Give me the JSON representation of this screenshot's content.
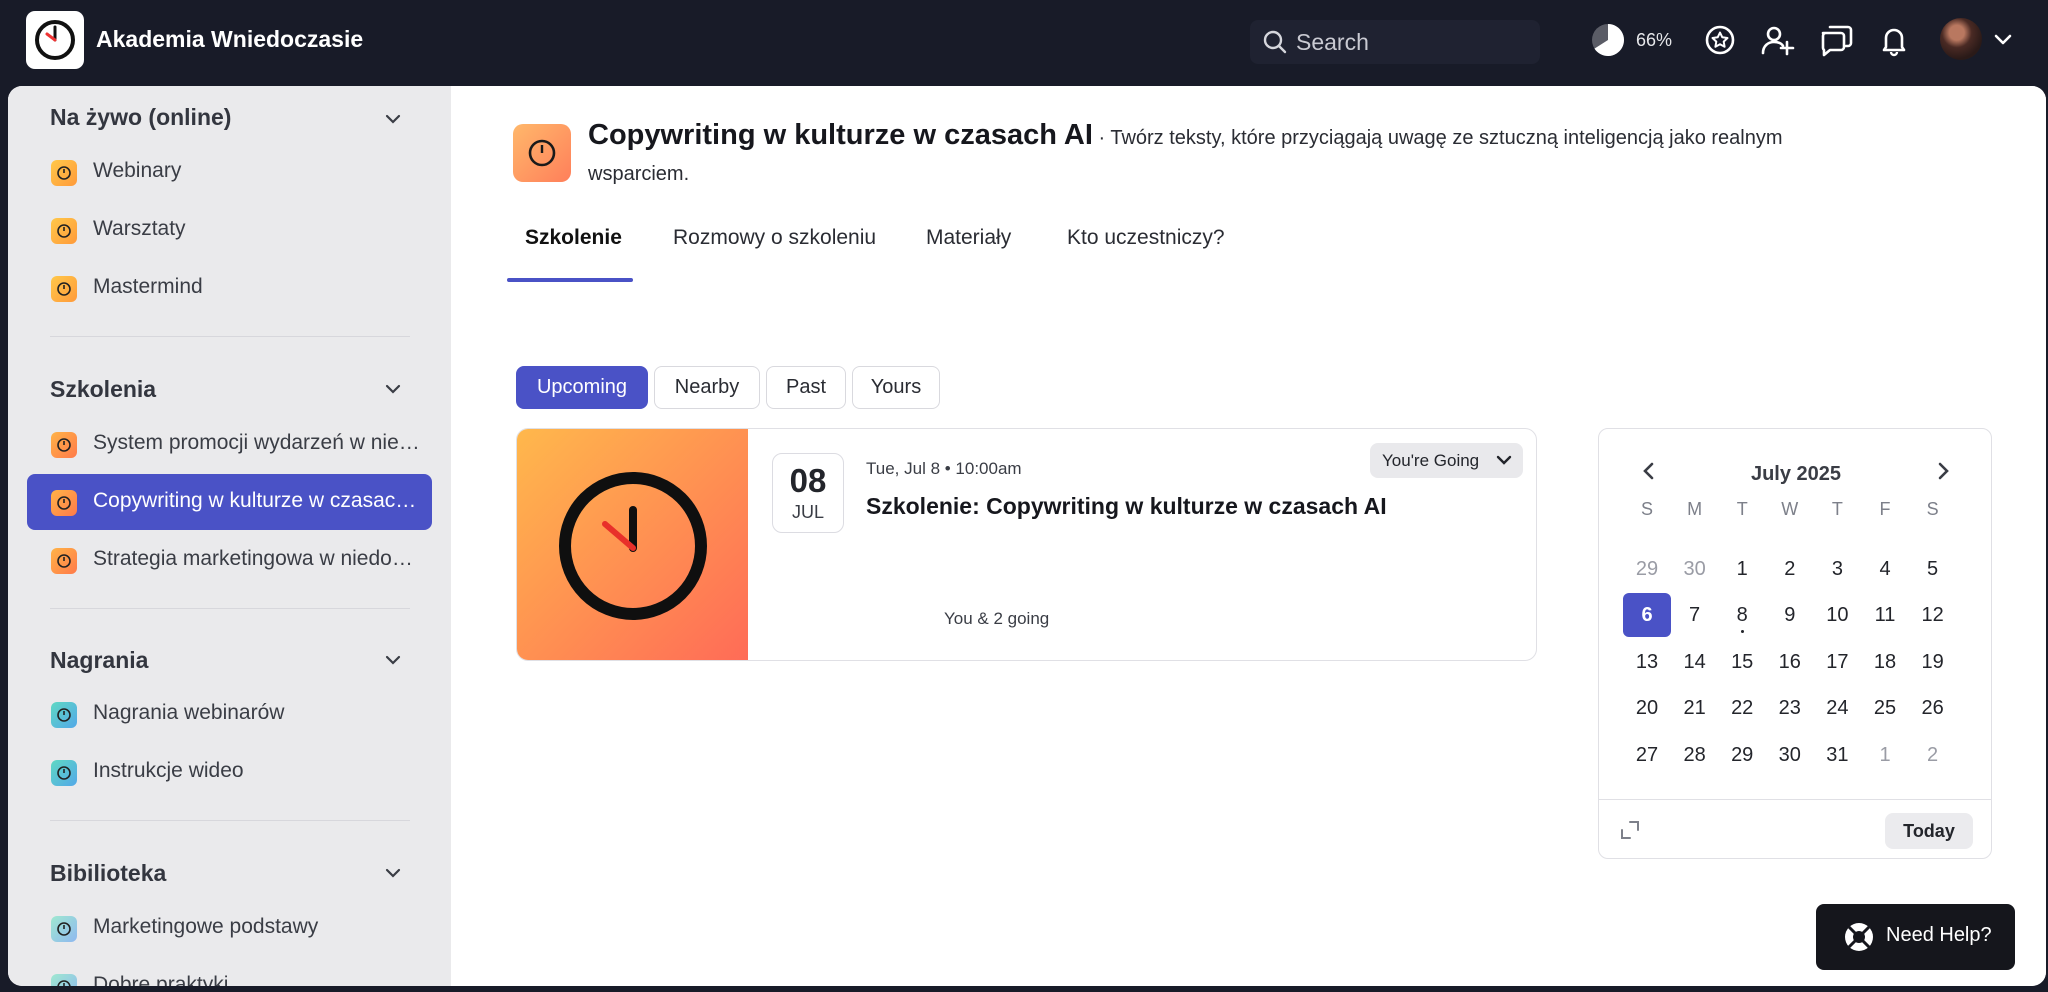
{
  "app": {
    "name": "Akademia Wniedoczasie"
  },
  "topbar": {
    "search_placeholder": "Search",
    "progress_label": "66%",
    "progress_value": 0.66
  },
  "sidebar": {
    "sections": [
      {
        "title": "Na żywo (online)",
        "items": [
          {
            "label": "Webinary",
            "icon": "clock-icon"
          },
          {
            "label": "Warsztaty",
            "icon": "clock-icon"
          },
          {
            "label": "Mastermind",
            "icon": "clock-icon"
          }
        ]
      },
      {
        "title": "Szkolenia",
        "items": [
          {
            "label": "System promocji wydarzeń w niedoczasie",
            "icon": "clock-icon"
          },
          {
            "label": "Copywriting w kulturze w czasach AI",
            "icon": "clock-icon",
            "active": true
          },
          {
            "label": "Strategia marketingowa w niedoczasie",
            "icon": "clock-icon"
          }
        ]
      },
      {
        "title": "Nagrania",
        "items": [
          {
            "label": "Nagrania webinarów",
            "icon": "clock-icon"
          },
          {
            "label": "Instrukcje wideo",
            "icon": "clock-icon"
          }
        ]
      },
      {
        "title": "Bibilioteka",
        "items": [
          {
            "label": "Marketingowe podstawy",
            "icon": "clock-icon"
          },
          {
            "label": "Dobre praktyki",
            "icon": "clock-icon"
          }
        ]
      }
    ]
  },
  "space": {
    "title": "Copywriting w kulturze w czasach AI",
    "separator": " · ",
    "description": "Twórz teksty, które przyciągają uwagę ze sztuczną inteligencją jako realnym wsparciem."
  },
  "tabs": [
    "Szkolenie",
    "Rozmowy o szkoleniu",
    "Materiały",
    "Kto uczestniczy?"
  ],
  "filters": [
    "Upcoming",
    "Nearby",
    "Past",
    "Yours"
  ],
  "event": {
    "day": "08",
    "month": "JUL",
    "when": "Tue, Jul 8 • 10:00am",
    "title": "Szkolenie: Copywriting w kulturze w czasach AI",
    "rsvp": "You're Going",
    "attendees": "You & 2 going"
  },
  "calendar": {
    "title": "July 2025",
    "dow": [
      "S",
      "M",
      "T",
      "W",
      "T",
      "F",
      "S"
    ],
    "weeks": [
      [
        "29",
        "30",
        "1",
        "2",
        "3",
        "4",
        "5"
      ],
      [
        "6",
        "7",
        "8",
        "9",
        "10",
        "11",
        "12"
      ],
      [
        "13",
        "14",
        "15",
        "16",
        "17",
        "18",
        "19"
      ],
      [
        "20",
        "21",
        "22",
        "23",
        "24",
        "25",
        "26"
      ],
      [
        "27",
        "28",
        "29",
        "30",
        "31",
        "1",
        "2"
      ]
    ],
    "selected": "6",
    "event_day": "8",
    "today_label": "Today"
  },
  "help": {
    "label": "Need Help?"
  },
  "colors": {
    "accent": "#4a52c6",
    "topbar": "#181b28"
  }
}
